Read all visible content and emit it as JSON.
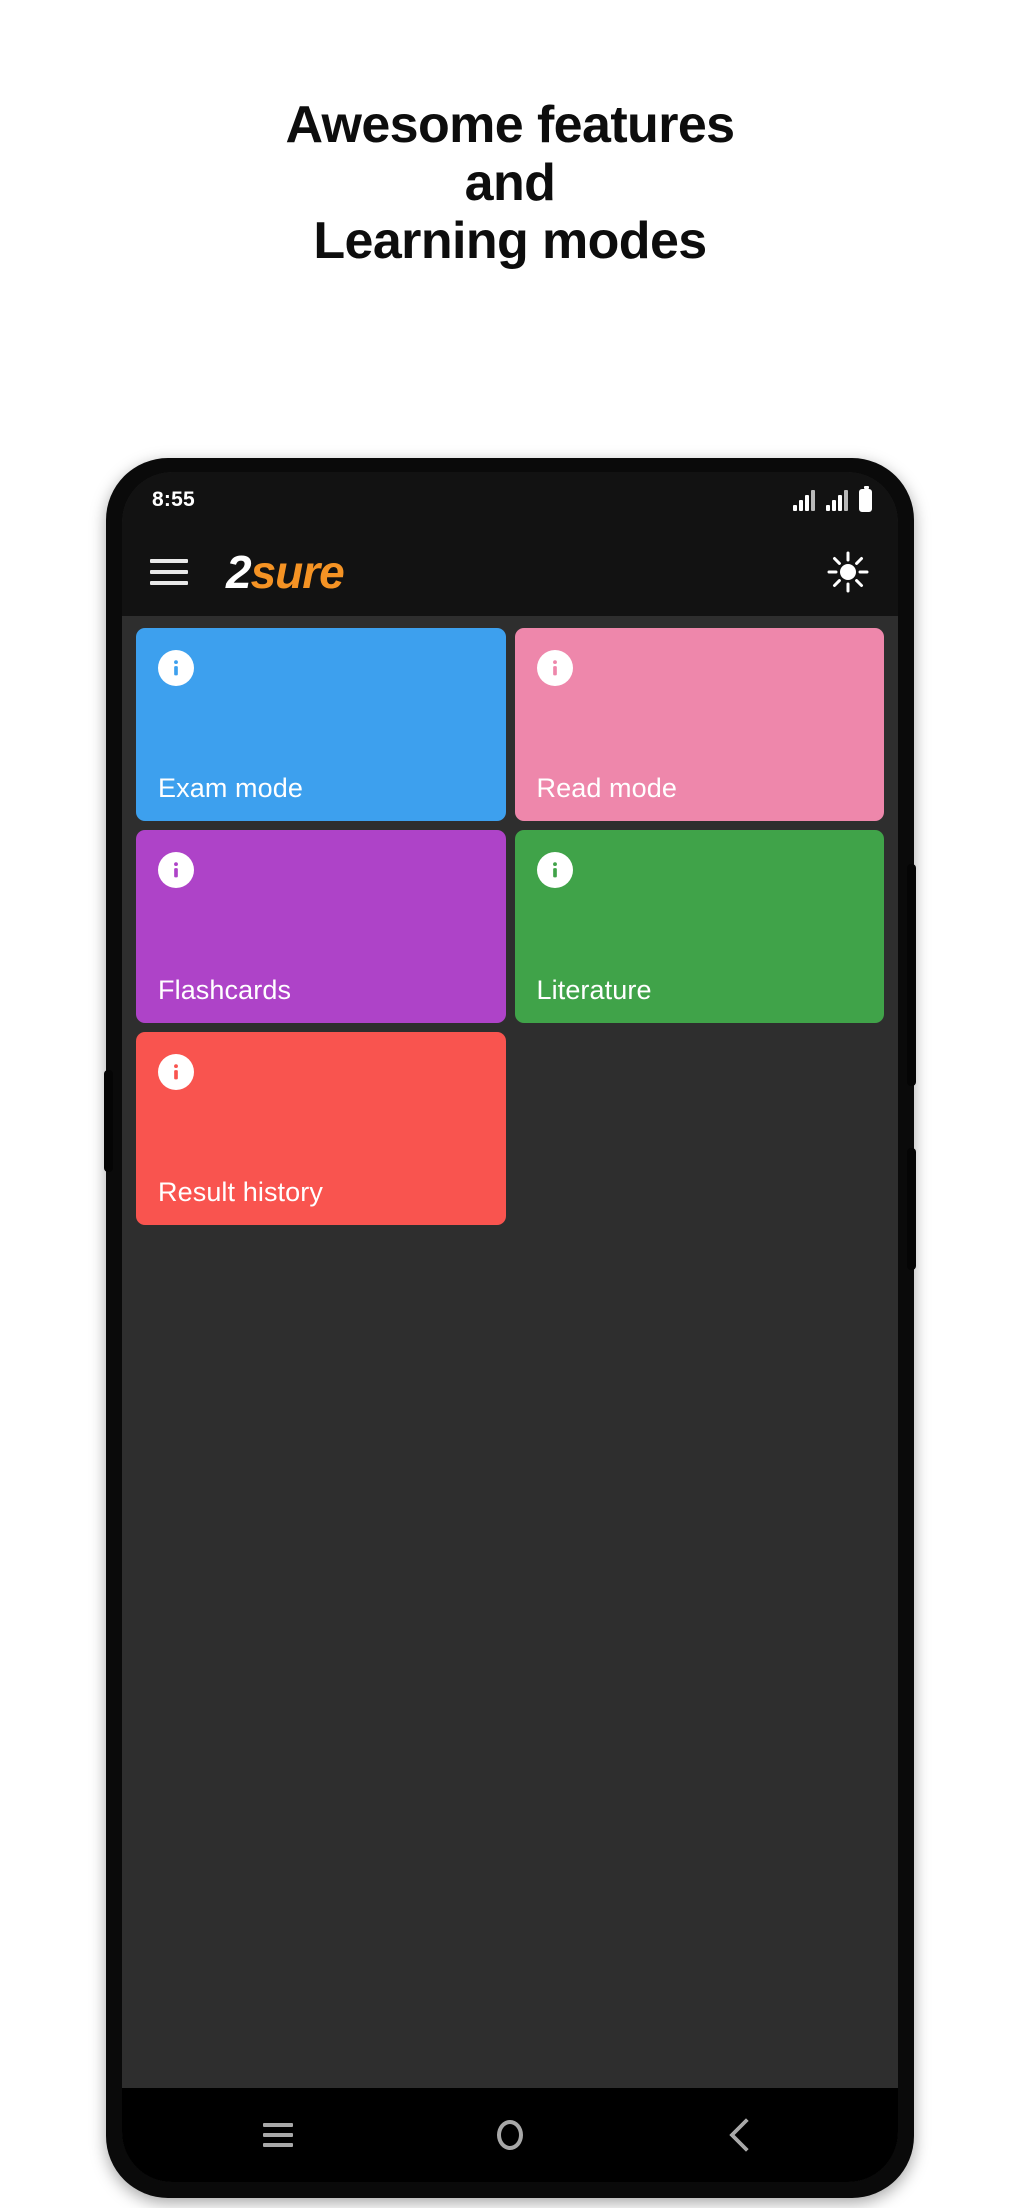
{
  "headline": {
    "lines": [
      "Awesome features",
      "and",
      "Learning modes"
    ]
  },
  "phone": {
    "status_bar": {
      "time": "8:55",
      "icons": [
        "signal-icon",
        "signal-icon",
        "battery-icon"
      ]
    },
    "app_bar": {
      "menu_icon": "hamburger-menu-icon",
      "logo_primary": "2",
      "logo_secondary": "sure",
      "brightness_icon": "sun-icon"
    },
    "tiles": [
      {
        "label": "Exam mode",
        "color": "#3da0ee",
        "icon": "info-icon"
      },
      {
        "label": "Read mode",
        "color": "#ee87ab",
        "icon": "info-icon"
      },
      {
        "label": "Flashcards",
        "color": "#ae43c8",
        "icon": "info-icon"
      },
      {
        "label": "Literature",
        "color": "#40a349",
        "icon": "info-icon"
      },
      {
        "label": "Result history",
        "color": "#f9544f",
        "icon": "info-icon"
      }
    ],
    "nav_bar": {
      "recents_label": "recents-icon",
      "home_label": "home-icon",
      "back_label": "back-icon"
    }
  },
  "colors": {
    "page_background": "#ffffff",
    "headline_text": "#0d0d0d",
    "app_bar_background": "#121212",
    "screen_background": "#2e2e2e",
    "nav_bar_background": "#000000",
    "logo_accent": "#f59324"
  }
}
